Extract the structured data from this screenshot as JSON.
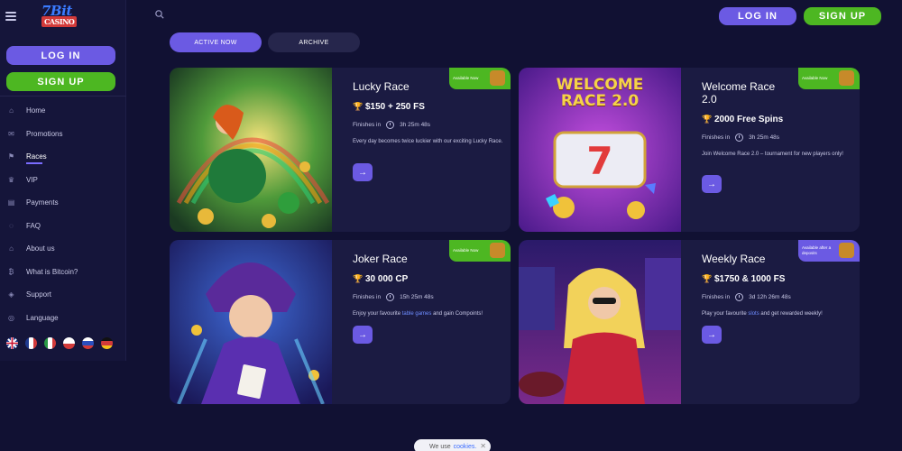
{
  "sidebar": {
    "logo_text": "7Bit",
    "logo_sub": "CASINO",
    "login_label": "LOG IN",
    "signup_label": "SIGN UP",
    "items": [
      {
        "label": "Home",
        "icon": "home-icon"
      },
      {
        "label": "Promotions",
        "icon": "promotions-icon"
      },
      {
        "label": "Races",
        "icon": "races-icon",
        "active": true
      },
      {
        "label": "VIP",
        "icon": "vip-crown-icon"
      },
      {
        "label": "Payments",
        "icon": "payments-icon"
      },
      {
        "label": "FAQ",
        "icon": "faq-icon"
      },
      {
        "label": "About us",
        "icon": "about-icon"
      },
      {
        "label": "What is Bitcoin?",
        "icon": "bitcoin-icon"
      },
      {
        "label": "Support",
        "icon": "support-icon"
      },
      {
        "label": "Language",
        "icon": "language-icon"
      }
    ],
    "flags": [
      "en",
      "fr",
      "it",
      "pl",
      "ru",
      "de"
    ]
  },
  "header": {
    "login_label": "LOG IN",
    "signup_label": "SIGN UP"
  },
  "tabs": [
    {
      "label": "ACTIVE NOW",
      "active": true
    },
    {
      "label": "ARCHIVE",
      "active": false
    }
  ],
  "cards": [
    {
      "title": "Lucky Race",
      "prize": "$150 + 250 FS",
      "finishes_label": "Finishes in",
      "countdown": "3h 25m 48s",
      "description": "Every day becomes twice luckier with our exciting Lucky Race.",
      "badge": "Available Now"
    },
    {
      "title": "Welcome Race 2.0",
      "prize": "2000 Free Spins",
      "finishes_label": "Finishes in",
      "countdown": "3h 25m 48s",
      "description": "Join Welcome Race 2.0 – tournament for new players only!",
      "badge": "Available Now",
      "image_text": "WELCOME RACE 2.0"
    },
    {
      "title": "Joker Race",
      "prize": "30 000 CP",
      "finishes_label": "Finishes in",
      "countdown": "15h 25m 48s",
      "description_pre": "Enjoy your favourite",
      "description_link": "table games",
      "description_post": "and gain Compoints!",
      "badge": "Available Now"
    },
    {
      "title": "Weekly Race",
      "prize": "$1750 & 1000 FS",
      "finishes_label": "Finishes in",
      "countdown": "3d 12h 26m 48s",
      "description_pre": "Play your favourite",
      "description_link": "slots",
      "description_post": "and get rewarded weekly!",
      "badge": "Available after a deposits"
    }
  ],
  "cookie": {
    "text": "We use",
    "link": "cookies."
  },
  "colors": {
    "background": "#111133",
    "sidebar": "#15153a",
    "card": "#1b1b42",
    "accent_purple": "#6b5ae3",
    "accent_green": "#4db722"
  }
}
